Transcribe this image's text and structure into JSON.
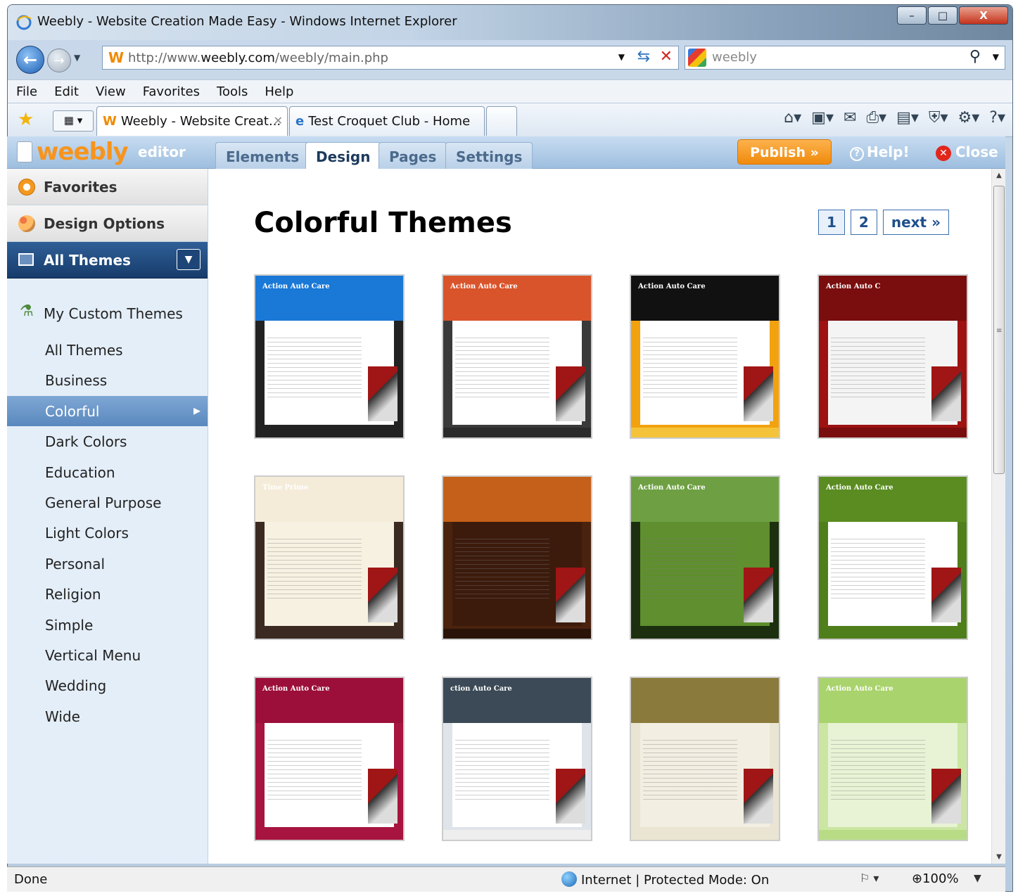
{
  "window": {
    "title": "Weebly - Website Creation Made Easy - Windows Internet Explorer",
    "controls": {
      "minimize": "–",
      "maximize": "□",
      "close": "X"
    }
  },
  "address": {
    "url_prefix": "http://www.",
    "url_domain": "weebly.com",
    "url_path": "/weebly/main.php",
    "search_value": "weebly"
  },
  "menu": [
    "File",
    "Edit",
    "View",
    "Favorites",
    "Tools",
    "Help"
  ],
  "browser_tabs": [
    {
      "label": "Weebly - Website Creat...",
      "active": true
    },
    {
      "label": "Test Croquet Club - Home",
      "active": false
    }
  ],
  "weebly": {
    "logo": "weebly",
    "logo_sub": "editor",
    "tabs": [
      "Elements",
      "Design",
      "Pages",
      "Settings"
    ],
    "active_tab": "Design",
    "publish_label": "Publish »",
    "help_label": "Help!",
    "close_label": "Close"
  },
  "sidebar": {
    "favorites": "Favorites",
    "design_options": "Design Options",
    "all_themes_header": "All Themes",
    "custom_themes": "My Custom Themes",
    "categories": [
      "All Themes",
      "Business",
      "Colorful",
      "Dark Colors",
      "Education",
      "General Purpose",
      "Light Colors",
      "Personal",
      "Religion",
      "Simple",
      "Vertical Menu",
      "Wedding",
      "Wide"
    ],
    "selected_category": "Colorful"
  },
  "main": {
    "title": "Colorful Themes",
    "pager": {
      "pages": [
        "1",
        "2"
      ],
      "current": "1",
      "next": "next »"
    },
    "themes": [
      {
        "label": "Action Auto Care",
        "head": "#1a78d6",
        "body": "#ffffff",
        "frame": "#222222",
        "foot": "#222222"
      },
      {
        "label": "Action Auto Care",
        "head": "#d9542b",
        "body": "#ffffff",
        "frame": "#3a3a3a",
        "foot": "#2b2b2b"
      },
      {
        "label": "Action Auto Care",
        "head": "#111111",
        "body": "#ffffff",
        "frame": "#f2a20f",
        "foot": "#f5c339"
      },
      {
        "label": "Action Auto C",
        "head": "#7a0d0d",
        "body": "#f4f4f4",
        "frame": "#9e1212",
        "foot": "#7a0d0d"
      },
      {
        "label": "Time Prime",
        "head": "#f4ecd9",
        "body": "#f7f1e2",
        "frame": "#3a2a22",
        "foot": "#3a2a22"
      },
      {
        "label": "",
        "head": "#c5601a",
        "body": "#3c1b0c",
        "frame": "#4a220e",
        "foot": "#2a1308"
      },
      {
        "label": "Action Auto Care",
        "head": "#6ea043",
        "body": "#5f8f2e",
        "frame": "#1c300f",
        "foot": "#1c300f"
      },
      {
        "label": "Action Auto Care",
        "head": "#5a8c21",
        "body": "#ffffff",
        "frame": "#4f7f1b",
        "foot": "#4f7f1b"
      },
      {
        "label": "Action Auto Care",
        "head": "#9b0f3a",
        "body": "#ffffff",
        "frame": "#a7143f",
        "foot": "#a7143f"
      },
      {
        "label": "ction Auto Care",
        "head": "#3b4a56",
        "body": "#ffffff",
        "frame": "#dfe4ea",
        "foot": "#eeeeee"
      },
      {
        "label": "",
        "head": "#8a7a3c",
        "body": "#f2efe2",
        "frame": "#e9e5d2",
        "foot": "#e9e5d2"
      },
      {
        "label": "Action Auto Care",
        "head": "#a9d36c",
        "body": "#e7f3d4",
        "frame": "#cbe6a3",
        "foot": "#b8dc85"
      }
    ]
  },
  "status": {
    "left": "Done",
    "zone": "Internet | Protected Mode: On",
    "zoom": "100%"
  }
}
